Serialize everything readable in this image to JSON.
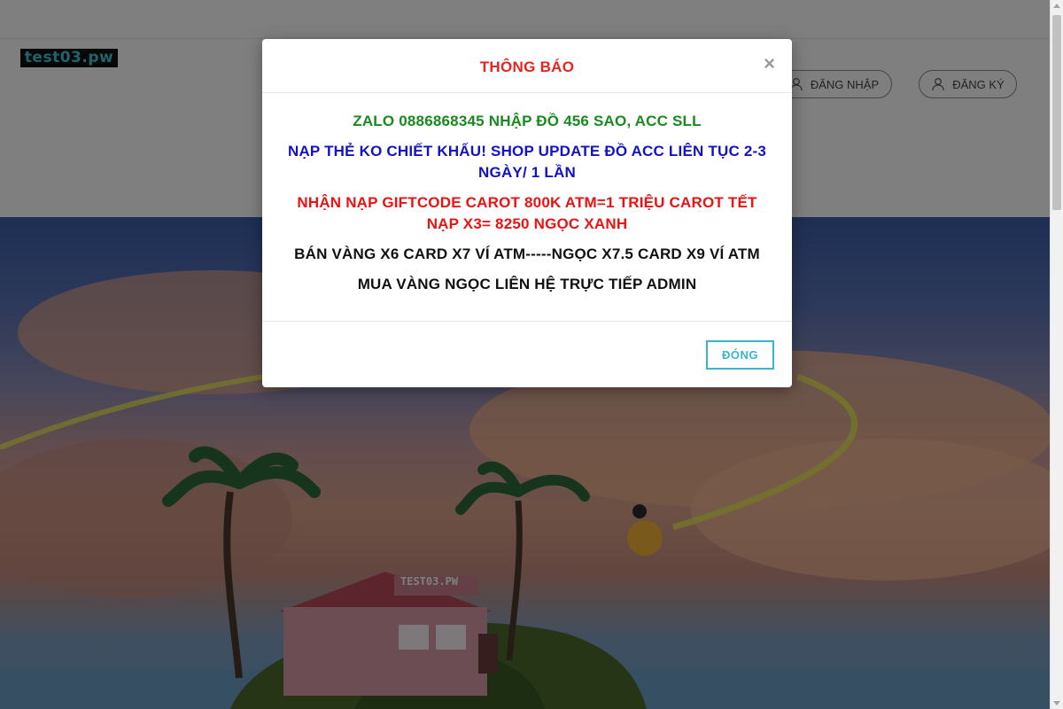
{
  "site": {
    "logo_text": "test03.pw"
  },
  "header": {
    "login_label": "ĐĂNG NHẬP",
    "register_label": "ĐĂNG KÝ"
  },
  "hero": {
    "house_sign": "TEST03.PW"
  },
  "modal": {
    "title": "THÔNG BÁO",
    "close_icon": "×",
    "messages": [
      {
        "text": "ZALO 0886868345 NHẬP ĐỒ 456 SAO, ACC SLL",
        "color": "#1a8a1f"
      },
      {
        "text": "NẠP THẺ KO CHIẾT KHẤU! SHOP UPDATE ĐỒ ACC LIÊN TỤC 2-3 NGÀY/ 1 LẦN",
        "color": "#1212c8"
      },
      {
        "text": "NHẬN NẠP GIFTCODE CAROT 800K ATM=1 TRIỆU CAROT TẾT NẠP X3= 8250 NGỌC XANH",
        "color": "#ee1111"
      },
      {
        "text": "BÁN VÀNG X6 CARD X7 VÍ ATM-----NGỌC X7.5 CARD X9 VÍ ATM",
        "color": "#111111"
      },
      {
        "text": "MUA VÀNG NGỌC LIÊN HỆ TRỰC TIẾP ADMIN",
        "color": "#111111"
      }
    ],
    "close_button_label": "ĐÓNG"
  },
  "colors": {
    "accent": "#36b6c8",
    "title_red": "#e8221c"
  },
  "icons": {
    "login": "user-icon",
    "register": "user-icon",
    "close": "close-icon"
  }
}
